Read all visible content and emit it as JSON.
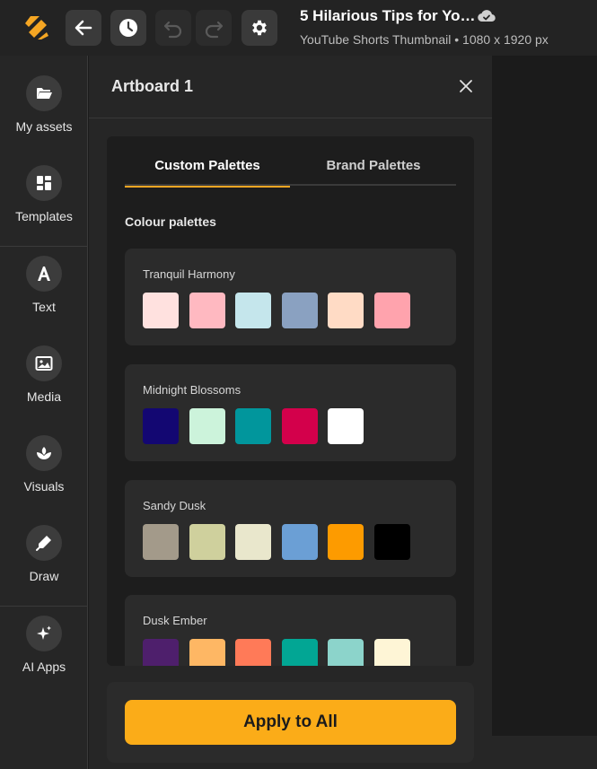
{
  "header": {
    "doc_title": "5 Hilarious Tips for Yo…",
    "doc_subtitle": "YouTube Shorts Thumbnail • 1080 x 1920 px"
  },
  "rail": {
    "items": [
      {
        "label": "My assets",
        "icon": "folder-icon"
      },
      {
        "label": "Templates",
        "icon": "templates-icon"
      },
      {
        "label": "Text",
        "icon": "text-icon"
      },
      {
        "label": "Media",
        "icon": "image-icon"
      },
      {
        "label": "Visuals",
        "icon": "visuals-icon"
      },
      {
        "label": "Draw",
        "icon": "pen-icon"
      },
      {
        "label": "AI Apps",
        "icon": "sparkle-icon"
      }
    ]
  },
  "panel": {
    "title": "Artboard 1",
    "tabs": [
      {
        "label": "Custom Palettes",
        "active": true
      },
      {
        "label": "Brand Palettes",
        "active": false
      }
    ],
    "section_label": "Colour palettes",
    "palettes": [
      {
        "name": "Tranquil Harmony",
        "colors": [
          "#FFE1DF",
          "#FFB9C1",
          "#C5E6EC",
          "#8AA1C1",
          "#FFDBC5",
          "#FFA3AD"
        ]
      },
      {
        "name": "Midnight Blossoms",
        "colors": [
          "#130772",
          "#CCF3DB",
          "#01969C",
          "#D3004B",
          "#FFFFFF"
        ]
      },
      {
        "name": "Sandy Dusk",
        "colors": [
          "#A39A8A",
          "#CFD09D",
          "#E9E7CC",
          "#6B9FD5",
          "#FD9B00",
          "#000000"
        ]
      },
      {
        "name": "Dusk Ember",
        "colors": [
          "#4E1F6C",
          "#FEB764",
          "#FF7A58",
          "#02A694",
          "#8CD4CB",
          "#FEF5D6"
        ]
      }
    ],
    "apply_label": "Apply to All"
  },
  "colors": {
    "accent": "#FBAC18",
    "logo": "#F5A623"
  }
}
